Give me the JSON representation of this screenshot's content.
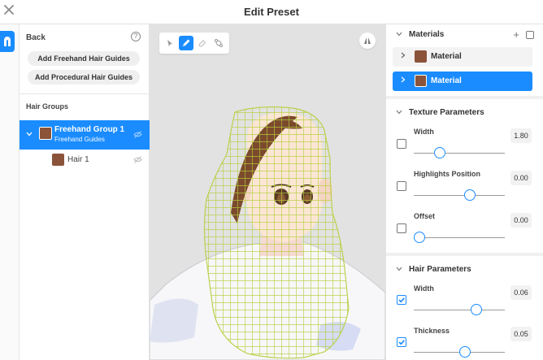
{
  "window": {
    "title": "Edit Preset",
    "close_icon": "close-icon"
  },
  "left_panel": {
    "back_label": "Back",
    "help_icon": "?",
    "buttons": [
      {
        "label": "Add Freehand Hair Guides"
      },
      {
        "label": "Add Procedural Hair Guides"
      }
    ],
    "hair_groups_label": "Hair Groups",
    "groups": [
      {
        "name": "Freehand Group 1",
        "subtitle": "Freehand Guides",
        "swatch": "#8b5339",
        "selected": true,
        "children": [
          {
            "name": "Hair 1",
            "swatch": "#8b5339"
          }
        ]
      }
    ]
  },
  "viewport": {
    "tools": [
      "select",
      "freehand-draw",
      "eraser",
      "path"
    ],
    "active_tool": "freehand-draw"
  },
  "right_panel": {
    "materials": {
      "title": "Materials",
      "add_label": "+",
      "items": [
        {
          "name": "Material",
          "swatch": "#8b5339",
          "selected": false
        },
        {
          "name": "Material",
          "swatch": "#8b5339",
          "selected": true
        }
      ]
    },
    "texture_parameters": {
      "title": "Texture Parameters",
      "params": [
        {
          "label": "Width",
          "value": "1.80",
          "checked": false,
          "level": 0.18
        },
        {
          "label": "Highlights Position",
          "value": "0.00",
          "checked": false,
          "level": 0.5
        },
        {
          "label": "Offset",
          "value": "0.00",
          "checked": false,
          "level": 0.0
        }
      ]
    },
    "hair_parameters": {
      "title": "Hair Parameters",
      "params": [
        {
          "label": "Width",
          "value": "0.06",
          "checked": true,
          "level": 0.56
        },
        {
          "label": "Thickness",
          "value": "0.05",
          "checked": true,
          "level": 0.45
        }
      ]
    }
  },
  "colors": {
    "accent": "#1a8cff",
    "hair_brown": "#8b5339",
    "guide_mesh": "#b6cf3c"
  }
}
